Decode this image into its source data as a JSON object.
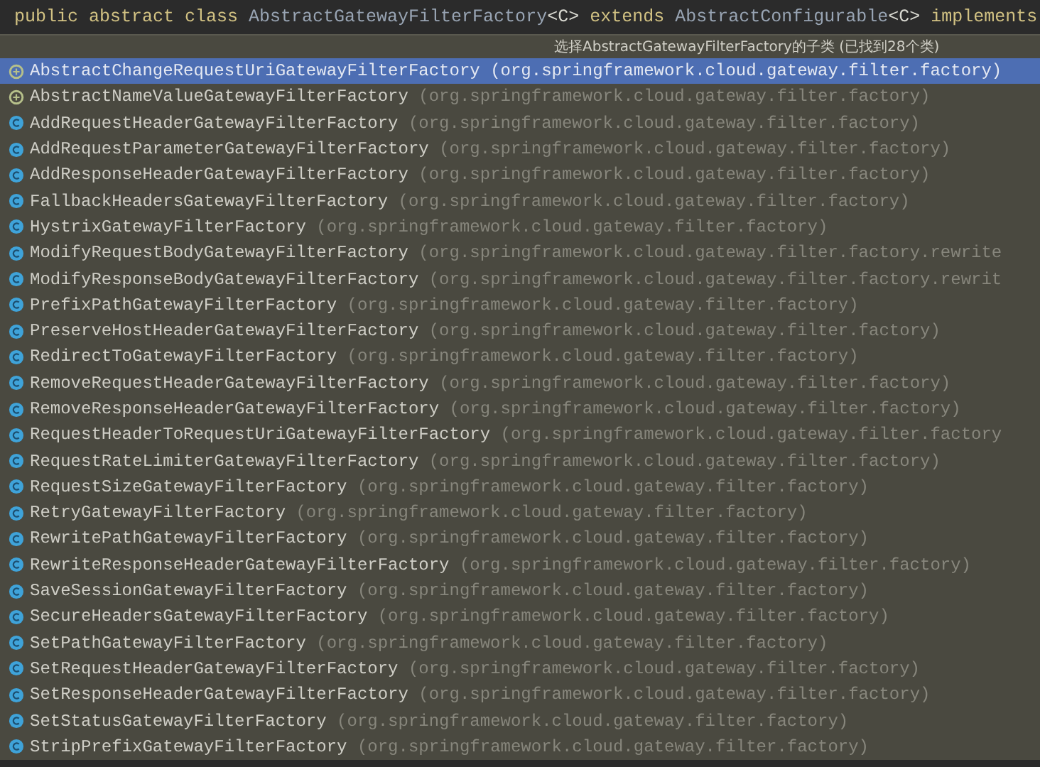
{
  "editor_line": [
    {
      "kind": "keyword",
      "text": "public abstract class "
    },
    {
      "kind": "type",
      "text": "AbstractGatewayFilterFactory"
    },
    {
      "kind": "plain",
      "text": "<C> "
    },
    {
      "kind": "keyword",
      "text": "extends "
    },
    {
      "kind": "type",
      "text": "AbstractConfigurable"
    },
    {
      "kind": "plain",
      "text": "<C> "
    },
    {
      "kind": "keyword",
      "text": "implements"
    }
  ],
  "popup": {
    "title": "选择AbstractGatewayFilterFactory的子类 (已找到28个类)",
    "items": [
      {
        "kind": "abstract",
        "name": "AbstractChangeRequestUriGatewayFilterFactory",
        "package": "(org.springframework.cloud.gateway.filter.factory)",
        "selected": true
      },
      {
        "kind": "abstract",
        "name": "AbstractNameValueGatewayFilterFactory",
        "package": "(org.springframework.cloud.gateway.filter.factory)",
        "selected": false
      },
      {
        "kind": "class",
        "name": "AddRequestHeaderGatewayFilterFactory",
        "package": "(org.springframework.cloud.gateway.filter.factory)",
        "selected": false
      },
      {
        "kind": "class",
        "name": "AddRequestParameterGatewayFilterFactory",
        "package": "(org.springframework.cloud.gateway.filter.factory)",
        "selected": false
      },
      {
        "kind": "class",
        "name": "AddResponseHeaderGatewayFilterFactory",
        "package": "(org.springframework.cloud.gateway.filter.factory)",
        "selected": false
      },
      {
        "kind": "class",
        "name": "FallbackHeadersGatewayFilterFactory",
        "package": "(org.springframework.cloud.gateway.filter.factory)",
        "selected": false
      },
      {
        "kind": "class",
        "name": "HystrixGatewayFilterFactory",
        "package": "(org.springframework.cloud.gateway.filter.factory)",
        "selected": false
      },
      {
        "kind": "class",
        "name": "ModifyRequestBodyGatewayFilterFactory",
        "package": "(org.springframework.cloud.gateway.filter.factory.rewrite",
        "selected": false
      },
      {
        "kind": "class",
        "name": "ModifyResponseBodyGatewayFilterFactory",
        "package": "(org.springframework.cloud.gateway.filter.factory.rewrit",
        "selected": false
      },
      {
        "kind": "class",
        "name": "PrefixPathGatewayFilterFactory",
        "package": "(org.springframework.cloud.gateway.filter.factory)",
        "selected": false
      },
      {
        "kind": "class",
        "name": "PreserveHostHeaderGatewayFilterFactory",
        "package": "(org.springframework.cloud.gateway.filter.factory)",
        "selected": false
      },
      {
        "kind": "class",
        "name": "RedirectToGatewayFilterFactory",
        "package": "(org.springframework.cloud.gateway.filter.factory)",
        "selected": false
      },
      {
        "kind": "class",
        "name": "RemoveRequestHeaderGatewayFilterFactory",
        "package": "(org.springframework.cloud.gateway.filter.factory)",
        "selected": false
      },
      {
        "kind": "class",
        "name": "RemoveResponseHeaderGatewayFilterFactory",
        "package": "(org.springframework.cloud.gateway.filter.factory)",
        "selected": false
      },
      {
        "kind": "class",
        "name": "RequestHeaderToRequestUriGatewayFilterFactory",
        "package": "(org.springframework.cloud.gateway.filter.factory",
        "selected": false
      },
      {
        "kind": "class",
        "name": "RequestRateLimiterGatewayFilterFactory",
        "package": "(org.springframework.cloud.gateway.filter.factory)",
        "selected": false
      },
      {
        "kind": "class",
        "name": "RequestSizeGatewayFilterFactory",
        "package": "(org.springframework.cloud.gateway.filter.factory)",
        "selected": false
      },
      {
        "kind": "class",
        "name": "RetryGatewayFilterFactory",
        "package": "(org.springframework.cloud.gateway.filter.factory)",
        "selected": false
      },
      {
        "kind": "class",
        "name": "RewritePathGatewayFilterFactory",
        "package": "(org.springframework.cloud.gateway.filter.factory)",
        "selected": false
      },
      {
        "kind": "class",
        "name": "RewriteResponseHeaderGatewayFilterFactory",
        "package": "(org.springframework.cloud.gateway.filter.factory)",
        "selected": false
      },
      {
        "kind": "class",
        "name": "SaveSessionGatewayFilterFactory",
        "package": "(org.springframework.cloud.gateway.filter.factory)",
        "selected": false
      },
      {
        "kind": "class",
        "name": "SecureHeadersGatewayFilterFactory",
        "package": "(org.springframework.cloud.gateway.filter.factory)",
        "selected": false
      },
      {
        "kind": "class",
        "name": "SetPathGatewayFilterFactory",
        "package": "(org.springframework.cloud.gateway.filter.factory)",
        "selected": false
      },
      {
        "kind": "class",
        "name": "SetRequestHeaderGatewayFilterFactory",
        "package": "(org.springframework.cloud.gateway.filter.factory)",
        "selected": false
      },
      {
        "kind": "class",
        "name": "SetResponseHeaderGatewayFilterFactory",
        "package": "(org.springframework.cloud.gateway.filter.factory)",
        "selected": false
      },
      {
        "kind": "class",
        "name": "SetStatusGatewayFilterFactory",
        "package": "(org.springframework.cloud.gateway.filter.factory)",
        "selected": false
      },
      {
        "kind": "class",
        "name": "StripPrefixGatewayFilterFactory",
        "package": "(org.springframework.cloud.gateway.filter.factory)",
        "selected": false
      }
    ]
  }
}
